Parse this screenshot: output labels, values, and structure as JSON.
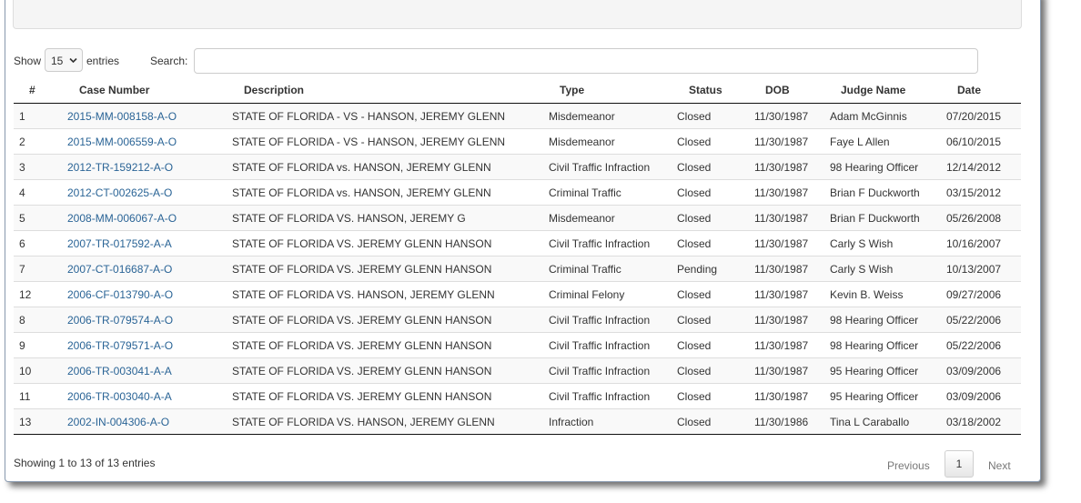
{
  "length": {
    "show_label": "Show",
    "selected": "15",
    "entries_label": "entries"
  },
  "search": {
    "label": "Search:",
    "value": "",
    "placeholder": ""
  },
  "table": {
    "headers": [
      "#",
      "Case Number",
      "Description",
      "Type",
      "Status",
      "DOB",
      "Judge Name",
      "Date"
    ],
    "rows": [
      [
        "1",
        "2015-MM-008158-A-O",
        "STATE OF FLORIDA - VS - HANSON, JEREMY GLENN",
        "Misdemeanor",
        "Closed",
        "11/30/1987",
        "Adam McGinnis",
        "07/20/2015"
      ],
      [
        "2",
        "2015-MM-006559-A-O",
        "STATE OF FLORIDA - VS - HANSON, JEREMY GLENN",
        "Misdemeanor",
        "Closed",
        "11/30/1987",
        "Faye L Allen",
        "06/10/2015"
      ],
      [
        "3",
        "2012-TR-159212-A-O",
        "STATE OF FLORIDA vs. HANSON, JEREMY GLENN",
        "Civil Traffic Infraction",
        "Closed",
        "11/30/1987",
        "98 Hearing Officer",
        "12/14/2012"
      ],
      [
        "4",
        "2012-CT-002625-A-O",
        "STATE OF FLORIDA vs. HANSON, JEREMY GLENN",
        "Criminal Traffic",
        "Closed",
        "11/30/1987",
        "Brian F Duckworth",
        "03/15/2012"
      ],
      [
        "5",
        "2008-MM-006067-A-O",
        "STATE OF FLORIDA VS. HANSON, JEREMY G",
        "Misdemeanor",
        "Closed",
        "11/30/1987",
        "Brian F Duckworth",
        "05/26/2008"
      ],
      [
        "6",
        "2007-TR-017592-A-A",
        "STATE OF FLORIDA VS. JEREMY GLENN HANSON",
        "Civil Traffic Infraction",
        "Closed",
        "11/30/1987",
        "Carly S Wish",
        "10/16/2007"
      ],
      [
        "7",
        "2007-CT-016687-A-O",
        "STATE OF FLORIDA VS. JEREMY GLENN HANSON",
        "Criminal Traffic",
        "Pending",
        "11/30/1987",
        "Carly S Wish",
        "10/13/2007"
      ],
      [
        "12",
        "2006-CF-013790-A-O",
        "STATE OF FLORIDA VS. HANSON, JEREMY GLENN",
        "Criminal Felony",
        "Closed",
        "11/30/1987",
        "Kevin B. Weiss",
        "09/27/2006"
      ],
      [
        "8",
        "2006-TR-079574-A-O",
        "STATE OF FLORIDA VS. JEREMY GLENN HANSON",
        "Civil Traffic Infraction",
        "Closed",
        "11/30/1987",
        "98 Hearing Officer",
        "05/22/2006"
      ],
      [
        "9",
        "2006-TR-079571-A-O",
        "STATE OF FLORIDA VS. JEREMY GLENN HANSON",
        "Civil Traffic Infraction",
        "Closed",
        "11/30/1987",
        "98 Hearing Officer",
        "05/22/2006"
      ],
      [
        "10",
        "2006-TR-003041-A-A",
        "STATE OF FLORIDA VS. JEREMY GLENN HANSON",
        "Civil Traffic Infraction",
        "Closed",
        "11/30/1987",
        "95 Hearing Officer",
        "03/09/2006"
      ],
      [
        "11",
        "2006-TR-003040-A-A",
        "STATE OF FLORIDA VS. JEREMY GLENN HANSON",
        "Civil Traffic Infraction",
        "Closed",
        "11/30/1987",
        "95 Hearing Officer",
        "03/09/2006"
      ],
      [
        "13",
        "2002-IN-004306-A-O",
        "STATE OF FLORIDA VS. HANSON, JEREMY GLENN",
        "Infraction",
        "Closed",
        "11/30/1986",
        "Tina L Caraballo",
        "03/18/2002"
      ]
    ]
  },
  "footer": {
    "info": "Showing 1 to 13 of 13 entries",
    "previous": "Previous",
    "current_page": "1",
    "next": "Next"
  },
  "colors": {
    "link": "#2a6496",
    "stripe": "#f9f9f9",
    "muted": "#777777"
  },
  "icons": {
    "select_caret": "chevron-down-icon"
  }
}
